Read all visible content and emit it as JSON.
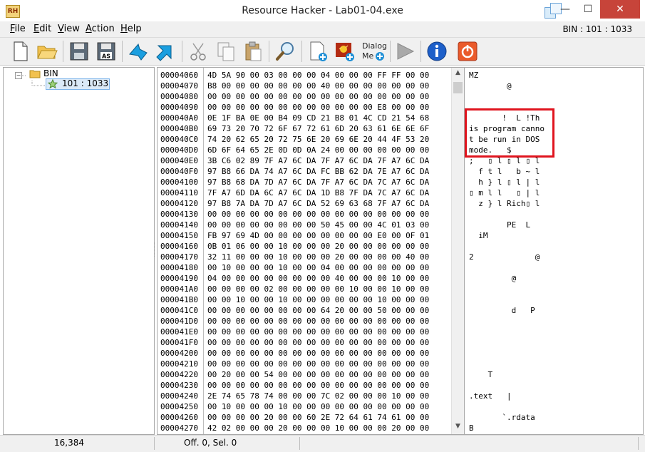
{
  "window": {
    "title": "Resource Hacker - Lab01-04.exe",
    "app_icon_text": "RH",
    "minimize_glyph": "—",
    "maximize_glyph": "☐",
    "close_glyph": "✕"
  },
  "menu": {
    "items": [
      {
        "u": "F",
        "rest": "ile"
      },
      {
        "u": "E",
        "rest": "dit"
      },
      {
        "u": "V",
        "rest": "iew"
      },
      {
        "u": "A",
        "rest": "ction"
      },
      {
        "u": "H",
        "rest": "elp"
      }
    ],
    "bin_indicator": "BIN : 101 : 1033"
  },
  "toolbar": {
    "icons": [
      "new-file-icon",
      "open-folder-icon",
      "save-icon",
      "save-as-icon",
      "back-arrow-icon",
      "forward-arrow-icon",
      "cut-icon",
      "copy-icon",
      "paste-icon",
      "search-icon",
      "add-resource-icon",
      "add-image-icon",
      "dialog-menu-icon",
      "play-icon",
      "info-icon",
      "power-icon"
    ],
    "save_as_label": "AS",
    "dialog_menu_label_top": "Dialog",
    "dialog_menu_label_bottom": "Me"
  },
  "tree": {
    "root_label": "BIN",
    "child_label": "101 : 1033",
    "expander": "−"
  },
  "hex": {
    "rows": [
      {
        "addr": "00004060",
        "bytes": "4D 5A 90 00 03 00 00 00 04 00 00 00 FF FF 00 00"
      },
      {
        "addr": "00004070",
        "bytes": "B8 00 00 00 00 00 00 00 40 00 00 00 00 00 00 00"
      },
      {
        "addr": "00004080",
        "bytes": "00 00 00 00 00 00 00 00 00 00 00 00 00 00 00 00"
      },
      {
        "addr": "00004090",
        "bytes": "00 00 00 00 00 00 00 00 00 00 00 00 E8 00 00 00"
      },
      {
        "addr": "000040A0",
        "bytes": "0E 1F BA 0E 00 B4 09 CD 21 B8 01 4C CD 21 54 68"
      },
      {
        "addr": "000040B0",
        "bytes": "69 73 20 70 72 6F 67 72 61 6D 20 63 61 6E 6E 6F"
      },
      {
        "addr": "000040C0",
        "bytes": "74 20 62 65 20 72 75 6E 20 69 6E 20 44 4F 53 20"
      },
      {
        "addr": "000040D0",
        "bytes": "6D 6F 64 65 2E 0D 0D 0A 24 00 00 00 00 00 00 00"
      },
      {
        "addr": "000040E0",
        "bytes": "3B C6 02 89 7F A7 6C DA 7F A7 6C DA 7F A7 6C DA"
      },
      {
        "addr": "000040F0",
        "bytes": "97 B8 66 DA 74 A7 6C DA FC BB 62 DA 7E A7 6C DA"
      },
      {
        "addr": "00004100",
        "bytes": "97 B8 68 DA 7D A7 6C DA 7F A7 6C DA 7C A7 6C DA"
      },
      {
        "addr": "00004110",
        "bytes": "7F A7 6D DA 6C A7 6C DA 1D B8 7F DA 7C A7 6C DA"
      },
      {
        "addr": "00004120",
        "bytes": "97 B8 7A DA 7D A7 6C DA 52 69 63 68 7F A7 6C DA"
      },
      {
        "addr": "00004130",
        "bytes": "00 00 00 00 00 00 00 00 00 00 00 00 00 00 00 00"
      },
      {
        "addr": "00004140",
        "bytes": "00 00 00 00 00 00 00 00 50 45 00 00 4C 01 03 00"
      },
      {
        "addr": "00004150",
        "bytes": "FB 97 69 4D 00 00 00 00 00 00 00 00 E0 00 0F 01"
      },
      {
        "addr": "00004160",
        "bytes": "0B 01 06 00 00 10 00 00 00 20 00 00 00 00 00 00"
      },
      {
        "addr": "00004170",
        "bytes": "32 11 00 00 00 10 00 00 00 20 00 00 00 00 40 00"
      },
      {
        "addr": "00004180",
        "bytes": "00 10 00 00 00 10 00 00 04 00 00 00 00 00 00 00"
      },
      {
        "addr": "00004190",
        "bytes": "04 00 00 00 00 00 00 00 00 40 00 00 00 10 00 00"
      },
      {
        "addr": "000041A0",
        "bytes": "00 00 00 00 02 00 00 00 00 00 10 00 00 10 00 00"
      },
      {
        "addr": "000041B0",
        "bytes": "00 00 10 00 00 10 00 00 00 00 00 00 10 00 00 00"
      },
      {
        "addr": "000041C0",
        "bytes": "00 00 00 00 00 00 00 00 64 20 00 00 50 00 00 00"
      },
      {
        "addr": "000041D0",
        "bytes": "00 00 00 00 00 00 00 00 00 00 00 00 00 00 00 00"
      },
      {
        "addr": "000041E0",
        "bytes": "00 00 00 00 00 00 00 00 00 00 00 00 00 00 00 00"
      },
      {
        "addr": "000041F0",
        "bytes": "00 00 00 00 00 00 00 00 00 00 00 00 00 00 00 00"
      },
      {
        "addr": "00004200",
        "bytes": "00 00 00 00 00 00 00 00 00 00 00 00 00 00 00 00"
      },
      {
        "addr": "00004210",
        "bytes": "00 00 00 00 00 00 00 00 00 00 00 00 00 00 00 00"
      },
      {
        "addr": "00004220",
        "bytes": "00 20 00 00 54 00 00 00 00 00 00 00 00 00 00 00"
      },
      {
        "addr": "00004230",
        "bytes": "00 00 00 00 00 00 00 00 00 00 00 00 00 00 00 00"
      },
      {
        "addr": "00004240",
        "bytes": "2E 74 65 78 74 00 00 00 7C 02 00 00 00 10 00 00"
      },
      {
        "addr": "00004250",
        "bytes": "00 10 00 00 00 10 00 00 00 00 00 00 00 00 00 00"
      },
      {
        "addr": "00004260",
        "bytes": "00 00 00 00 20 00 00 60 2E 72 64 61 74 61 00 00"
      },
      {
        "addr": "00004270",
        "bytes": "42 02 00 00 00 20 00 00 00 10 00 00 00 20 00 00"
      }
    ],
    "scroll_up_glyph": "▲",
    "scroll_down_glyph": "▼"
  },
  "ascii": {
    "rows": [
      "MZ",
      "        @",
      "",
      "",
      "       !  L !Th",
      "is program canno",
      "t be run in DOS",
      "mode.   $",
      ";   ▯ l ▯ l ▯ l",
      "  f t l   b ~ l",
      "  h } l ▯ l | l",
      "▯ m l l   ▯ | l",
      "  z } l Rich▯ l",
      "",
      "        PE  L",
      "  iM",
      "",
      "2             @",
      "",
      "         @",
      "",
      "",
      "         d   P",
      "",
      "",
      "",
      "",
      "",
      "    T",
      "",
      ".text   |",
      "",
      "       `.rdata",
      "B"
    ]
  },
  "status": {
    "size": "16,384",
    "offset": "Off. 0, Sel. 0"
  },
  "colors": {
    "close_button": "#c7443a",
    "highlight_box": "#e0141e"
  }
}
